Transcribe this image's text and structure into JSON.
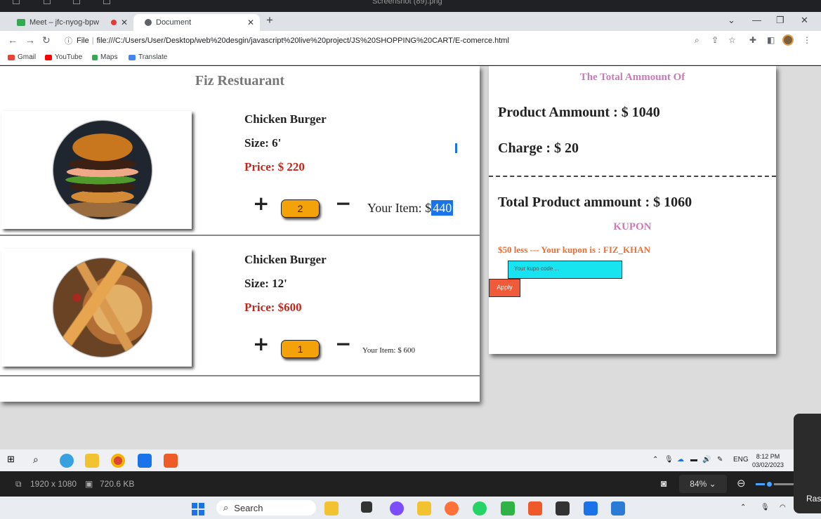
{
  "topbar": {
    "title": "Screenshot (89).png"
  },
  "tabs": [
    {
      "label": "Meet – jfc-nyog-bpw",
      "active": false,
      "recording": true
    },
    {
      "label": "Document",
      "active": true
    }
  ],
  "address": {
    "prefix": "File",
    "url": "file:///C:/Users/User/Desktop/web%20desgin/javascript%20live%20project/JS%20SHOPPING%20CART/E-comerce.html"
  },
  "bookmarks": [
    "Gmail",
    "YouTube",
    "Maps",
    "Translate"
  ],
  "shop": {
    "title": "Fiz Restuarant",
    "items": [
      {
        "name": "Chicken Burger",
        "size": "Size: 6'",
        "price": "Price: $ 220",
        "qty": "2",
        "item_label": "Your Item: $",
        "item_value": "440",
        "image": "burger"
      },
      {
        "name": "Chicken Burger",
        "size": "Size: 12'",
        "price": "Price: $600",
        "qty": "1",
        "item_label": "Your Item: $ 600",
        "item_value": "",
        "image": "pizza"
      }
    ],
    "plus": "+",
    "minus": "−"
  },
  "total": {
    "heading": "The Total Ammount Of",
    "product": "Product Ammount : $ 1040",
    "charge": "Charge : $ 20",
    "grand": "Total Product ammount : $ 1060",
    "kupon_title": "KUPON",
    "kupon_msg": "$50 less --- Your kupon is : FIZ_KHAN",
    "kupon_placeholder": "Your kupo code ...",
    "apply": "Apply"
  },
  "tray": {
    "lang": "ENG",
    "time": "8:12 PM",
    "date": "03/02/2023"
  },
  "viewer": {
    "resolution": "1920 x 1080",
    "filesize": "720.6 KB",
    "zoom": "84%"
  },
  "taskbar": {
    "search": "Search"
  },
  "sidetab": {
    "label": "Ras"
  },
  "colors": {
    "accent": "#1a73e8",
    "qty": "#f3a20a",
    "price": "#c0281d",
    "kupon_input": "#18e3f0",
    "apply": "#f05a38",
    "heading": "#c97ab8"
  }
}
